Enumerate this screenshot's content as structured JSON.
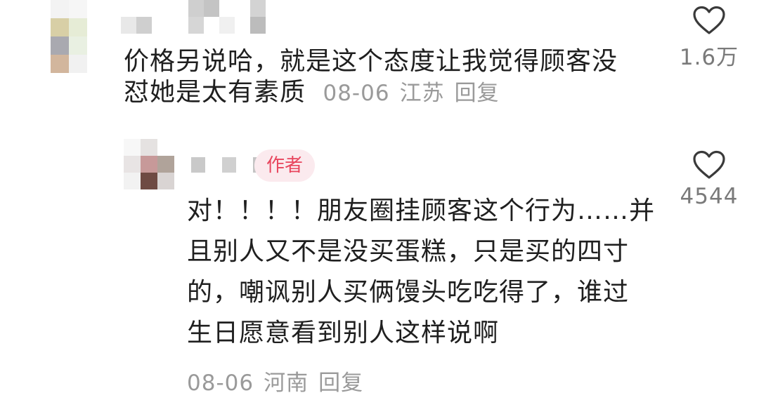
{
  "comment": {
    "text_line1": "价格另说哈，就是这个态度让我觉得顾客没",
    "text_line2": "怼她是太有素质",
    "date": "08-06",
    "location": "江苏",
    "reply_label": "回复",
    "like_icon": "heart-outline-icon",
    "like_count": "1.6万"
  },
  "reply": {
    "author_badge": "作者",
    "text_lines": [
      "对！！！！朋友圈挂顾客这个行为……并",
      "且别人又不是没买蛋糕，只是买的四寸",
      "的，嘲讽别人买俩馒头吃吃得了，谁过",
      "生日愿意看到别人这样说啊"
    ],
    "date": "08-06",
    "location": "河南",
    "reply_label": "回复",
    "like_icon": "heart-outline-icon",
    "like_count": "4544"
  },
  "colors": {
    "text": "#1f1f1f",
    "meta": "#9a9a9a",
    "badge_bg": "#fbeaee",
    "badge_text": "#e8455d"
  }
}
